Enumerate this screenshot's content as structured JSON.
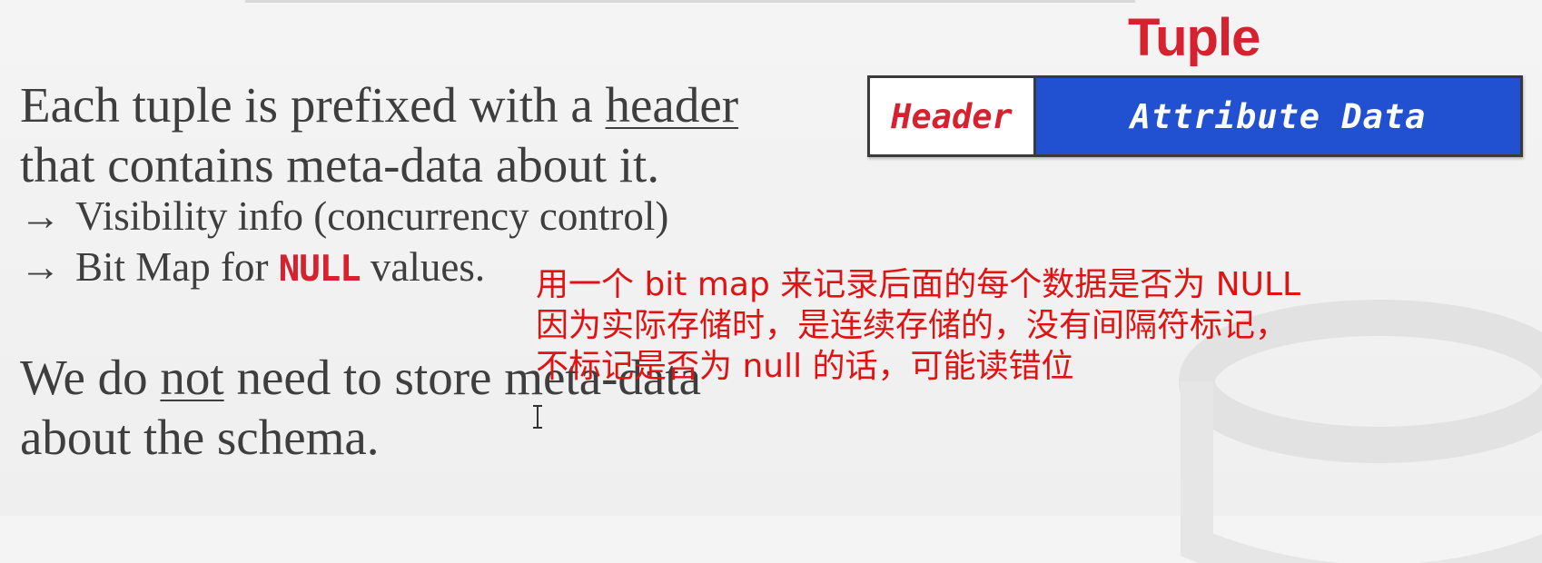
{
  "diagram": {
    "title": "Tuple",
    "header_label": "Header",
    "attribute_label": "Attribute Data",
    "colors": {
      "accent_red": "#d6222e",
      "attribute_blue": "#2150d1"
    }
  },
  "slide": {
    "line1_pre": "Each tuple is prefixed with a ",
    "line1_underlined": "header",
    "line2": "that contains meta-data about it.",
    "bullet_arrow": "→",
    "bullet1": "Visibility info (concurrency control)",
    "bullet2_pre": "Bit Map for ",
    "bullet2_keyword": "NULL",
    "bullet2_post": " values.",
    "line3_pre": "We do ",
    "line3_underlined": "not",
    "line3_post": " need to store meta-data",
    "line4": "about the schema."
  },
  "annotation": {
    "lines": [
      "用一个 bit map 来记录后面的每个数据是否为 NULL",
      "因为实际存储时，是连续存储的，没有间隔符标记，",
      "不标记是否为 null 的话，可能读错位"
    ],
    "color": "#e01212"
  }
}
